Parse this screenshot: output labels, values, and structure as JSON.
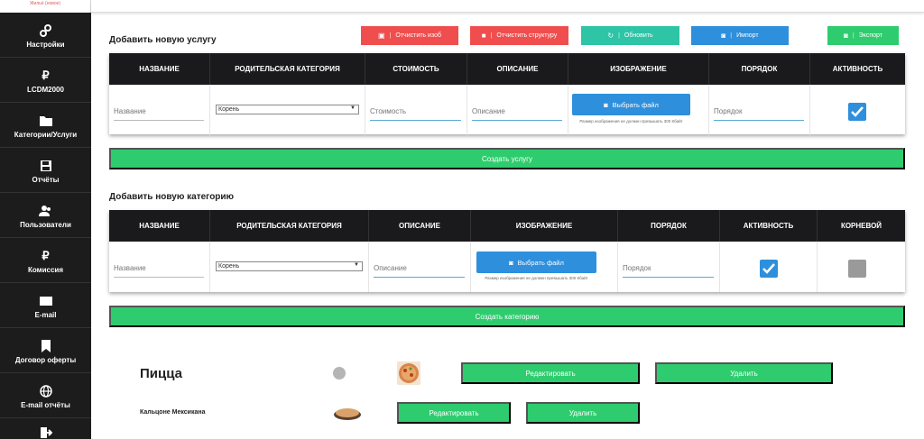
{
  "sidebar": {
    "logo_text": "Жильё (новое)",
    "items": [
      {
        "label": "Настройки",
        "icon": "gears-icon"
      },
      {
        "label": "LCDM2000",
        "icon": "ruble-icon"
      },
      {
        "label": "Категории/Услуги",
        "icon": "folder-icon"
      },
      {
        "label": "Отчёты",
        "icon": "floppy-disk-icon"
      },
      {
        "label": "Пользователи",
        "icon": "users-icon"
      },
      {
        "label": "Комиссия",
        "icon": "ruble-icon"
      },
      {
        "label": "E-mail",
        "icon": "envelope-icon"
      },
      {
        "label": "Договор оферты",
        "icon": "bookmark-icon"
      },
      {
        "label": "E-mail отчёты",
        "icon": "globe-icon"
      },
      {
        "label": "",
        "icon": "logout-icon"
      }
    ]
  },
  "service": {
    "title": "Добавить новую услугу",
    "toolbar": {
      "clear_images": "Отчистить изоб",
      "clear_structure": "Отчистить структуру",
      "refresh": "Обновить",
      "import": "Импорт",
      "export": "Экспорт"
    },
    "columns": [
      "Название",
      "Родительская категория",
      "Стоимость",
      "Описание",
      "Изображение",
      "Порядок",
      "Активность"
    ],
    "name_placeholder": "Название",
    "parent_value": "Корень",
    "price_placeholder": "Стоимость",
    "description_placeholder": "Описание",
    "file_button": "Выбрать файл",
    "file_hint": "Размер изображения не должен превышать 300 Кбайт",
    "order_placeholder": "Порядок",
    "active": true,
    "create_button": "Создать услугу"
  },
  "category": {
    "title": "Добавить новую категорию",
    "columns": [
      "Название",
      "Родительская категория",
      "Описание",
      "Изображение",
      "Порядок",
      "Активность",
      "Корневой"
    ],
    "name_placeholder": "Название",
    "parent_value": "Корень",
    "description_placeholder": "Описание",
    "file_button": "Выбрать файл",
    "file_hint": "Размер изображения не должен превышать 300 Кбайт",
    "order_placeholder": "Порядок",
    "active": true,
    "root": false,
    "create_button": "Создать категорию"
  },
  "items": [
    {
      "name": "Пицца",
      "edit": "Редактировать",
      "delete": "Удалить"
    },
    {
      "name": "Кальцоне Мексикана",
      "edit": "Редактировать",
      "delete": "Удалить"
    }
  ],
  "colors": {
    "sidebar": "#1c1c1c",
    "red": "#f04e4e",
    "teal": "#2ec4a6",
    "blue": "#2e8fdc",
    "green": "#2ecc6e",
    "header": "#1a1a1c"
  }
}
